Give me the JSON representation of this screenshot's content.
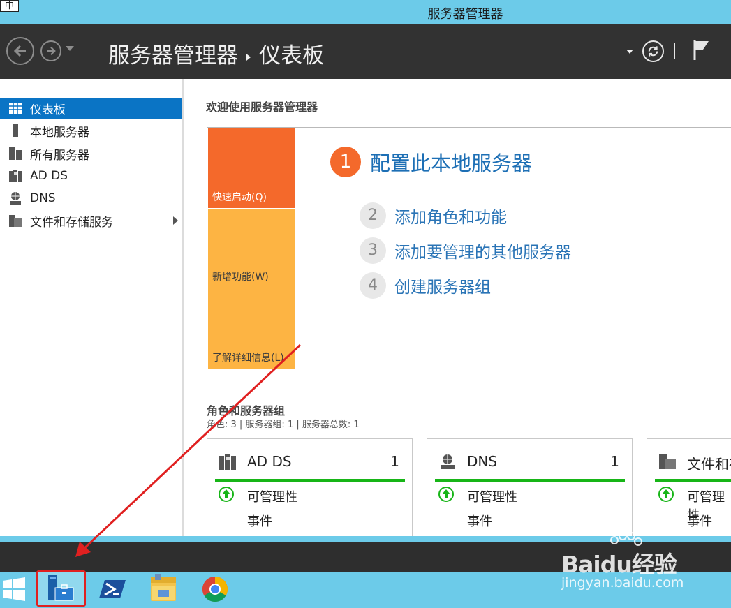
{
  "window": {
    "title": "服务器管理器",
    "ime_indicator": "中"
  },
  "header": {
    "breadcrumb_root": "服务器管理器",
    "breadcrumb_current": "仪表板"
  },
  "sidebar": {
    "items": [
      {
        "label": "仪表板",
        "icon": "dashboard-icon",
        "active": true
      },
      {
        "label": "本地服务器",
        "icon": "local-server-icon"
      },
      {
        "label": "所有服务器",
        "icon": "all-servers-icon"
      },
      {
        "label": "AD DS",
        "icon": "adds-icon"
      },
      {
        "label": "DNS",
        "icon": "dns-icon"
      },
      {
        "label": "文件和存储服务",
        "icon": "file-storage-icon",
        "has_submenu": true
      }
    ]
  },
  "welcome": {
    "title": "欢迎使用服务器管理器",
    "tiles": [
      "快速启动(Q)",
      "新增功能(W)",
      "了解详细信息(L)"
    ],
    "steps": [
      {
        "num": "1",
        "label": "配置此本地服务器"
      },
      {
        "num": "2",
        "label": "添加角色和功能"
      },
      {
        "num": "3",
        "label": "添加要管理的其他服务器"
      },
      {
        "num": "4",
        "label": "创建服务器组"
      }
    ]
  },
  "roles": {
    "title": "角色和服务器组",
    "summary": "角色: 3 | 服务器组: 1 | 服务器总数: 1",
    "cards": [
      {
        "name": "AD DS",
        "count": "1",
        "manageability": "可管理性",
        "events": "事件",
        "icon": "adds-icon"
      },
      {
        "name": "DNS",
        "count": "1",
        "manageability": "可管理性",
        "events": "事件",
        "icon": "dns-icon"
      },
      {
        "name": "文件和存储服务",
        "count": "",
        "manageability": "可管理性",
        "events": "事件",
        "icon": "file-storage-icon"
      }
    ]
  },
  "taskbar": {
    "items": [
      "start-icon",
      "server-manager-icon",
      "powershell-icon",
      "file-explorer-icon",
      "chrome-icon"
    ]
  },
  "watermark": {
    "brand": "Baidu经验",
    "url": "jingyan.baidu.com"
  },
  "colors": {
    "accent": "#0a74c5",
    "orange": "#f4692b",
    "amber": "#fdb443",
    "ok_green": "#17b517",
    "annotation_red": "#e02020"
  }
}
